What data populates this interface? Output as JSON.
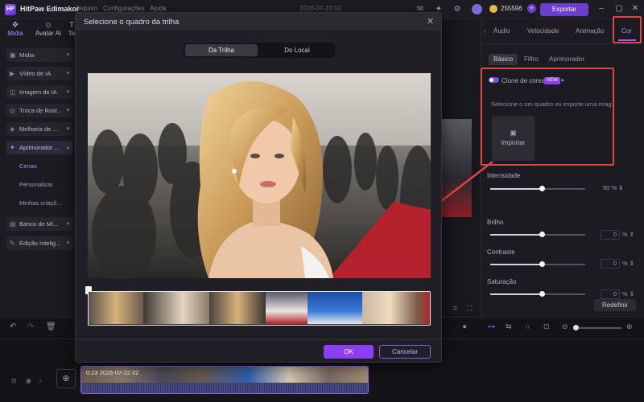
{
  "app": {
    "title": "HitPaw Edimakor",
    "menu": [
      "Arquivo",
      "Configurações",
      "Ajuda"
    ],
    "datetime": "2026-07-23 02",
    "credits": "255596",
    "export_label": "Exportar"
  },
  "left_panel": {
    "tabs": [
      {
        "label": "Mídia",
        "icon": "media-icon"
      },
      {
        "label": "Avatar AI",
        "icon": "avatar-icon"
      },
      {
        "label": "Te",
        "icon": "text-icon"
      }
    ],
    "items": [
      {
        "label": "Mídia",
        "icon": "folder-icon"
      },
      {
        "label": "Vídeo de IA",
        "icon": "video-icon"
      },
      {
        "label": "Imagem de IA",
        "icon": "image-icon"
      },
      {
        "label": "Troca de Rost...",
        "icon": "face-icon"
      },
      {
        "label": "Melhoria de ...",
        "icon": "enhance-icon"
      },
      {
        "label": "Aprimorador ...",
        "icon": "sparkle-icon"
      }
    ],
    "subitems": [
      "Cenas",
      "Personalizar",
      "Minhas criaçõ..."
    ],
    "items_bottom": [
      {
        "label": "Banco de Mí...",
        "icon": "bank-icon"
      },
      {
        "label": "Edição Intelig...",
        "icon": "smart-edit-icon"
      }
    ]
  },
  "right_panel": {
    "tabs": [
      "Áudio",
      "Velocidade",
      "Animação",
      "Cor"
    ],
    "subtabs": [
      "Básico",
      "Filtro",
      "Aprimorador"
    ],
    "color_clone": {
      "label": "Clone de cores",
      "badge": "NEW",
      "hint": "Selecione o um quadro ou importe uma imag...",
      "import_label": "Importar"
    },
    "sliders": [
      {
        "label": "Intensidade",
        "value": "50",
        "unit": "%",
        "fraction": 0.5
      },
      {
        "label": "Brilho",
        "value": "0",
        "unit": "%",
        "fraction": 0.5
      },
      {
        "label": "Contraste",
        "value": "0",
        "unit": "%",
        "fraction": 0.5
      },
      {
        "label": "Saturação",
        "value": "0",
        "unit": "%",
        "fraction": 0.5
      }
    ],
    "reset_label": "Redefinir"
  },
  "dialog": {
    "title": "Selecione o quadro da trilha",
    "close_icon": "close-icon",
    "source_tabs": [
      "Da Trilha",
      "Do Local"
    ],
    "active_source": "Da Trilha",
    "ok_label": "OK",
    "cancel_label": "Cancelar"
  },
  "timeline": {
    "clip_label": "0:23  2026-07-22 02"
  },
  "colors": {
    "accent": "#8a3ff0",
    "annotation": "#e04545",
    "carpet": "#b5212c"
  }
}
